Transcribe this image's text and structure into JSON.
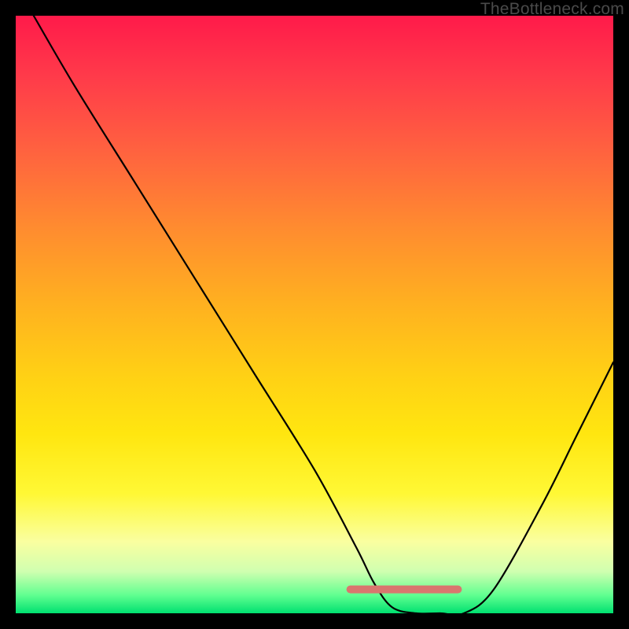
{
  "watermark": "TheBottleneck.com",
  "chart_data": {
    "type": "line",
    "title": "",
    "xlabel": "",
    "ylabel": "",
    "xlim": [
      0,
      100
    ],
    "ylim": [
      0,
      100
    ],
    "series": [
      {
        "name": "bottleneck-curve",
        "x": [
          3,
          10,
          20,
          30,
          40,
          50,
          57,
          60,
          63,
          67,
          71,
          75,
          80,
          88,
          94,
          100
        ],
        "values": [
          100,
          88,
          72,
          56,
          40,
          24,
          11,
          5,
          1,
          0,
          0,
          0,
          4,
          18,
          30,
          42
        ]
      },
      {
        "name": "highlight-band",
        "x": [
          56,
          74
        ],
        "values": [
          4,
          4
        ]
      }
    ],
    "gradient_stops": [
      {
        "pos": 0,
        "color": "#ff1a4a"
      },
      {
        "pos": 10,
        "color": "#ff3a4a"
      },
      {
        "pos": 22,
        "color": "#ff6040"
      },
      {
        "pos": 35,
        "color": "#ff8a30"
      },
      {
        "pos": 48,
        "color": "#ffb020"
      },
      {
        "pos": 60,
        "color": "#ffd015"
      },
      {
        "pos": 70,
        "color": "#ffe610"
      },
      {
        "pos": 80,
        "color": "#fff835"
      },
      {
        "pos": 88,
        "color": "#faffa0"
      },
      {
        "pos": 93,
        "color": "#d0ffb0"
      },
      {
        "pos": 97,
        "color": "#60ff90"
      },
      {
        "pos": 100,
        "color": "#00e070"
      }
    ],
    "highlight_color": "#d9766e"
  }
}
